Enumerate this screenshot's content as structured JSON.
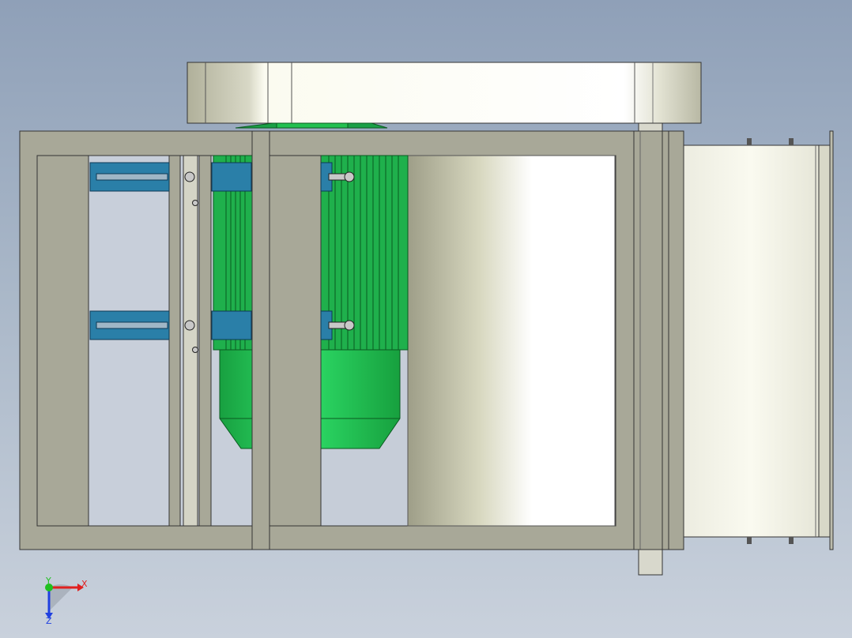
{
  "viewport": {
    "background_top": "#8fa0b8",
    "background_bottom": "#c9d1dc"
  },
  "model": {
    "frame_color": "#a8a898",
    "belt_guard_color": "#f2f2e6",
    "motor_color": "#26c85a",
    "bracket_color": "#2a7fa8",
    "fan_housing_color": "#f4f4e8"
  },
  "triad": {
    "x_label": "X",
    "y_label": "Y",
    "z_label": "Z",
    "x_color": "#e02020",
    "y_color": "#20c020",
    "z_color": "#2040e0",
    "icon": "coordinate-triad-icon"
  }
}
